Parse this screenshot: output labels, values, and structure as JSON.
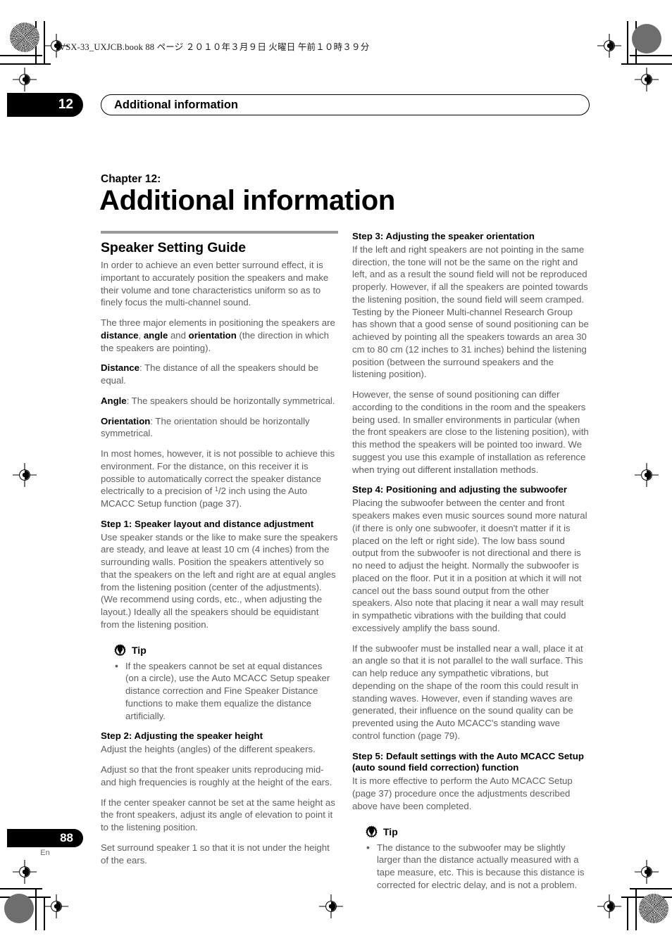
{
  "book_meta": "VSX-33_UXJCB.book   88 ページ   ２０１０年３月９日   火曜日   午前１０時３９分",
  "running_header": {
    "chapter_number": "12",
    "title": "Additional information"
  },
  "chapter": {
    "label": "Chapter 12:",
    "title": "Additional information"
  },
  "left_column": {
    "section_title": "Speaker Setting Guide",
    "intro_1": "In order to achieve an even better surround effect, it is important to accurately position the speakers and make their volume and tone characteristics uniform so as to finely focus the multi-channel sound.",
    "intro_2_pre": "The three major elements in positioning the speakers are ",
    "intro_2_b1": "distance",
    "intro_2_mid1": ", ",
    "intro_2_b2": "angle",
    "intro_2_mid2": " and ",
    "intro_2_b3": "orientation",
    "intro_2_post": " (the direction in which the speakers are pointing).",
    "distance_term": "Distance",
    "distance_text": ": The distance of all the speakers should be equal.",
    "angle_term": "Angle",
    "angle_text": ": The speakers should be horizontally symmetrical.",
    "orientation_term": "Orientation",
    "orientation_text": ": The orientation should be horizontally symmetrical.",
    "precision_pre": "In most homes, however, it is not possible to achieve this environment. For the distance, on this receiver it is possible to automatically correct the speaker distance electrically to a precision of ",
    "precision_frac_num": "1",
    "precision_frac_rest": "/2",
    "precision_post": " inch using the Auto MCACC Setup function (page 37).",
    "step1_heading": "Step 1: Speaker layout and distance adjustment",
    "step1_text": "Use speaker stands or the like to make sure the speakers are steady, and leave at least 10 cm (4 inches) from the surrounding walls. Position the speakers attentively so that the speakers on the left and right are at equal angles from the listening position (center of the adjustments). (We recommend using cords, etc., when adjusting the layout.) Ideally all the speakers should be equidistant from the listening position.",
    "tip_label": "Tip",
    "tip_icon": "gear-lightbulb-icon",
    "tip_bullet_1": "If the speakers cannot be set at equal distances (on a circle), use the Auto MCACC Setup speaker distance correction and Fine Speaker Distance functions to make them equalize the distance artificially.",
    "step2_heading": "Step 2: Adjusting the speaker height",
    "step2_text_1": "Adjust the heights (angles) of the different speakers.",
    "step2_text_2": "Adjust so that the front speaker units reproducing mid- and high frequencies is roughly at the height of the ears.",
    "step2_text_3": "If the center speaker cannot be set at the same height as the front speakers, adjust its angle of elevation to point it to the listening position.",
    "step2_text_4": "Set surround speaker 1 so that it is not under the height of the ears."
  },
  "right_column": {
    "step3_heading": "Step 3: Adjusting the speaker orientation",
    "step3_text_1": "If the left and right speakers are not pointing in the same direction, the tone will not be the same on the right and left, and as a result the sound field will not be reproduced properly. However, if all the speakers are pointed towards the listening position, the sound field will seem cramped. Testing by the Pioneer Multi-channel Research Group has shown that a good sense of sound positioning can be achieved by pointing all the speakers towards an area 30 cm to 80 cm (12 inches to 31 inches) behind the listening position (between the surround speakers and the listening position).",
    "step3_text_2": "However, the sense of sound positioning can differ according to the conditions in the room and the speakers being used. In smaller environments in particular (when the front speakers are close to the listening position), with this method the speakers will be pointed too inward. We suggest you use this example of installation as reference when trying out different installation methods.",
    "step4_heading": "Step 4: Positioning and adjusting the subwoofer",
    "step4_text_1": "Placing the subwoofer between the center and front speakers makes even music sources sound more natural (if there is only one subwoofer, it doesn't matter if it is placed on the left or right side). The low bass sound output from the subwoofer is not directional and there is no need to adjust the height. Normally the subwoofer is placed on the floor. Put it in a position at which it will not cancel out the bass sound output from the other speakers. Also note that placing it near a wall may result in sympathetic vibrations with the building that could excessively amplify the bass sound.",
    "step4_text_2": "If the subwoofer must be installed near a wall, place it at an angle so that it is not parallel to the wall surface. This can help reduce any sympathetic vibrations, but depending on the shape of the room this could result in standing waves. However, even if standing waves are generated, their influence on the sound quality can be prevented using the Auto MCACC's standing wave control function (page 79).",
    "step5_heading": "Step 5: Default settings with the Auto MCACC Setup (auto sound field correction) function",
    "step5_text_1": "It is more effective to perform the Auto MCACC Setup (page 37) procedure once the adjustments described above have been completed.",
    "tip_label": "Tip",
    "tip_icon": "gear-lightbulb-icon",
    "tip_bullet_1": "The distance to the subwoofer may be slightly larger than the distance actually measured with a tape measure, etc. This is because this distance is corrected for electric delay, and is not a problem."
  },
  "footer": {
    "page_number": "88",
    "language": "En"
  },
  "colors": {
    "body_text": "#5d5d5d",
    "heading_text": "#000000",
    "rule": "#9a9a9a",
    "pill_background": "#000000"
  }
}
